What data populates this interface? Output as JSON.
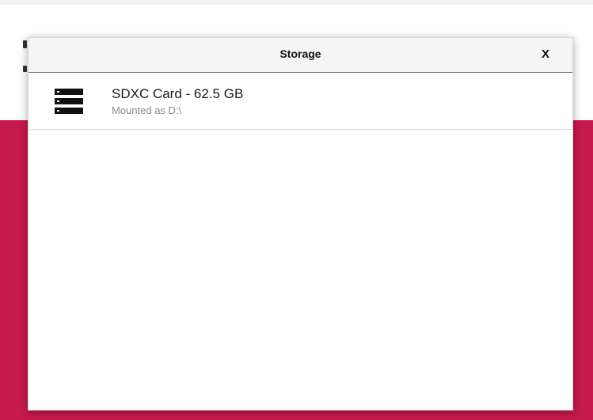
{
  "dialog": {
    "title": "Storage",
    "close_label": "X"
  },
  "devices": [
    {
      "icon": "storage-drive-icon",
      "title": "SDXC Card - 62.5 GB",
      "subtitle": "Mounted as D:\\"
    }
  ],
  "colors": {
    "accent_background": "#c51a4a",
    "dialog_background": "#ffffff",
    "header_background": "#f5f5f5"
  }
}
